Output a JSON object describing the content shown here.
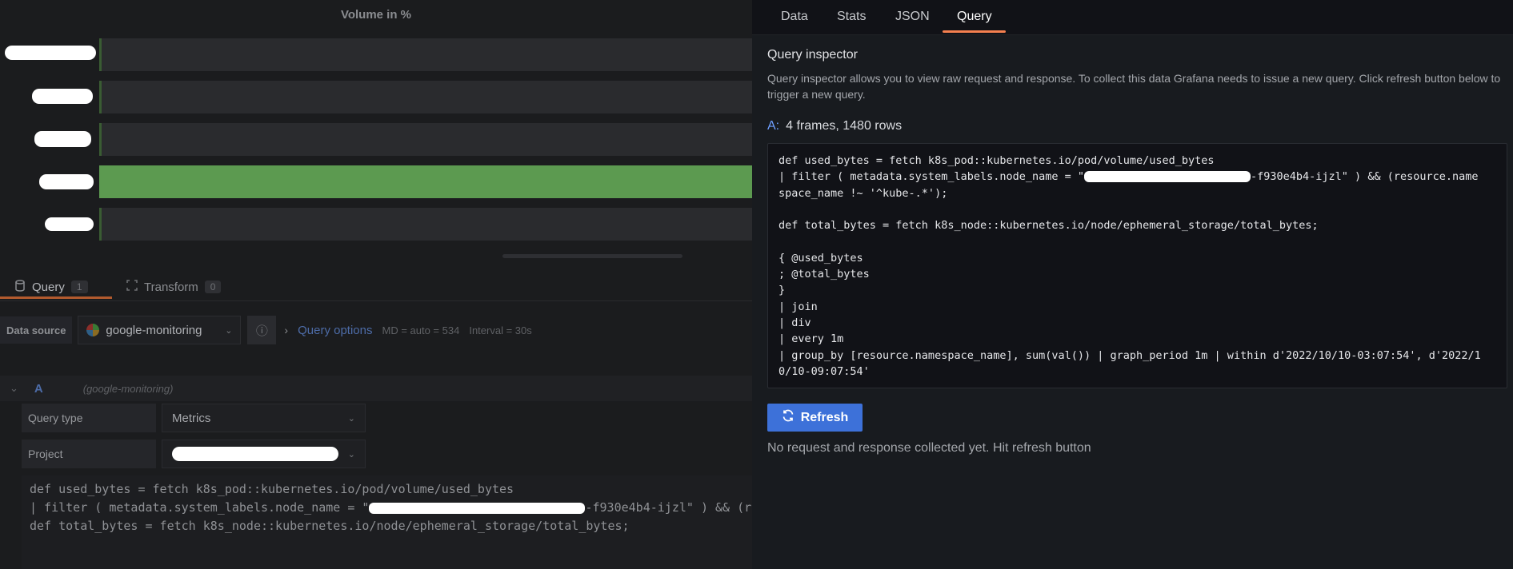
{
  "panel": {
    "title": "Volume in %"
  },
  "chart_data": {
    "type": "bar",
    "categories": [
      "",
      "",
      "",
      "",
      ""
    ],
    "values": [
      0,
      0,
      0,
      100,
      0
    ],
    "title": "Volume in %"
  },
  "editor": {
    "tabs": [
      {
        "label": "Query",
        "count": "1"
      },
      {
        "label": "Transform",
        "count": "0"
      }
    ],
    "datasource_label": "Data source",
    "datasource_value": "google-monitoring",
    "query_options_label": "Query options",
    "md_text": "MD = auto = 534",
    "interval_text": "Interval = 30s",
    "query_letter": "A",
    "query_ds_name": "(google-monitoring)",
    "query_type_label": "Query type",
    "query_type_value": "Metrics",
    "project_label": "Project",
    "code_line1": "def used_bytes = fetch k8s_pod::kubernetes.io/pod/volume/used_bytes",
    "code_line2a": "| filter ( metadata.system_labels.node_name = \"",
    "code_line2b": "-f930e4b4-ijzl\" ) && (r",
    "code_line3": "",
    "code_line4": "def total_bytes = fetch k8s_node::kubernetes.io/node/ephemeral_storage/total_bytes;"
  },
  "inspector": {
    "tabs": [
      "Data",
      "Stats",
      "JSON",
      "Query"
    ],
    "active_tab": "Query",
    "title": "Query inspector",
    "description": "Query inspector allows you to view raw request and response. To collect this data Grafana needs to issue a new query. Click refresh button below to trigger a new query.",
    "frames_label": "A:",
    "frames_text": "4 frames, 1480 rows",
    "code": {
      "l1": "def used_bytes = fetch k8s_pod::kubernetes.io/pod/volume/used_bytes",
      "l2a": "| filter ( metadata.system_labels.node_name = \"",
      "l2b": "-f930e4b4-ijzl\" ) && (resource.name",
      "l3": "space_name !~ '^kube-.*');",
      "l4": "",
      "l5": "def total_bytes = fetch k8s_node::kubernetes.io/node/ephemeral_storage/total_bytes;",
      "l6": "",
      "l7": "{ @used_bytes",
      "l8": "; @total_bytes",
      "l9": "}",
      "l10": "| join",
      "l11": "| div",
      "l12": "| every 1m",
      "l13": "| group_by [resource.namespace_name], sum(val()) | graph_period 1m | within d'2022/10/10-03:07:54', d'2022/1",
      "l14": "0/10-09:07:54'"
    },
    "refresh_label": "Refresh",
    "empty_text": "No request and response collected yet. Hit refresh button"
  }
}
